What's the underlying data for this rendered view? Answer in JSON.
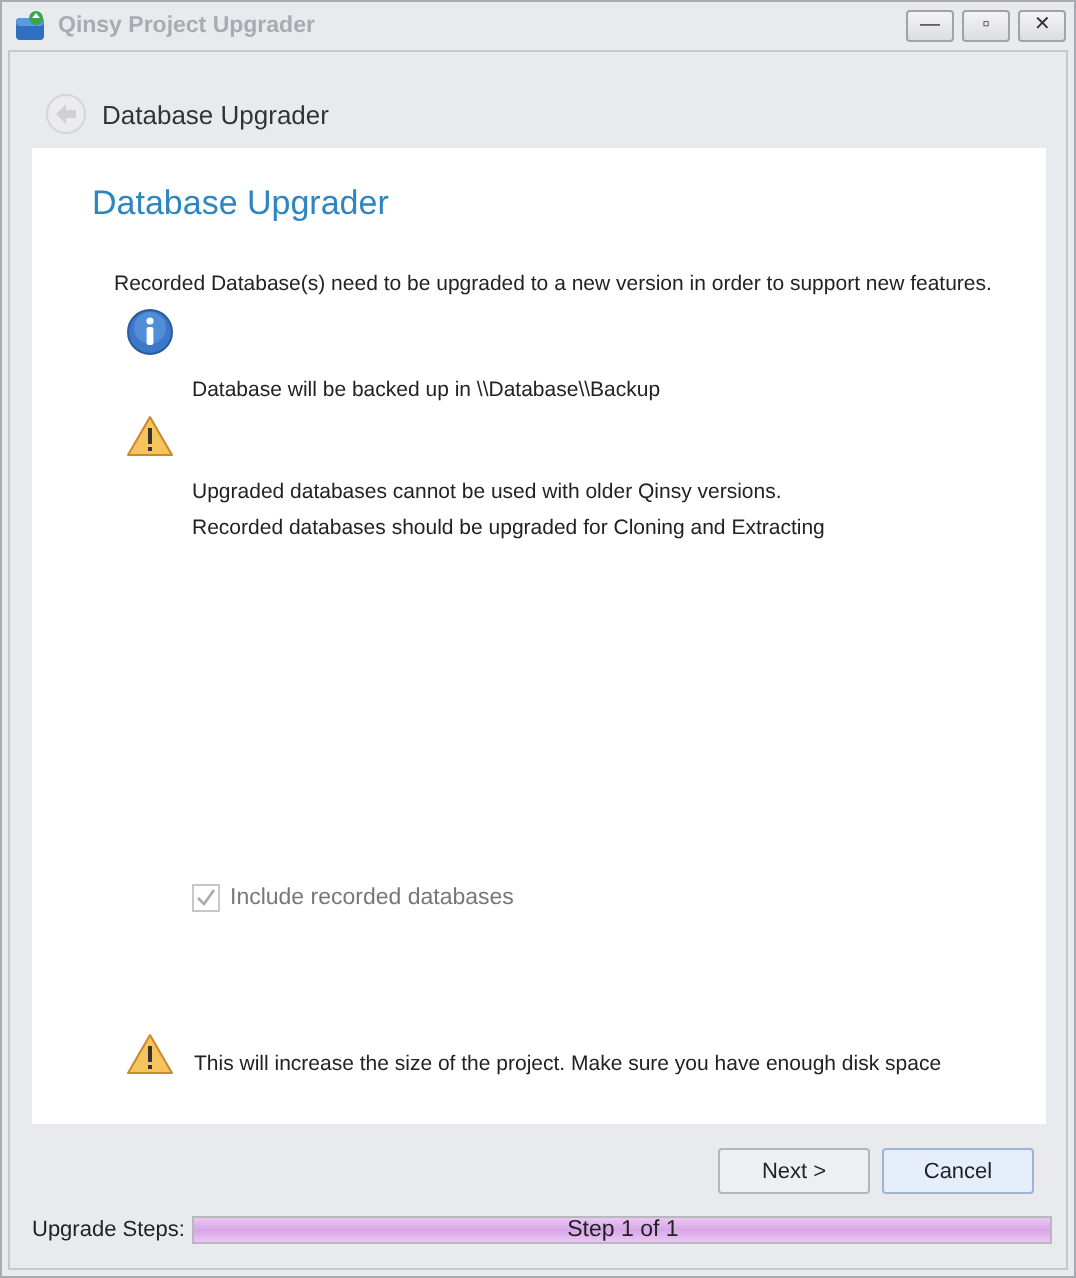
{
  "window": {
    "title": "Qinsy Project Upgrader",
    "controls": [
      "—",
      "▫",
      "✕"
    ]
  },
  "header": {
    "title": "Database Upgrader",
    "back_disabled": true
  },
  "panel": {
    "title": "Database Upgrader",
    "intro": "Recorded Database(s) need to be upgraded to a new version in order to support new features.",
    "messages": [
      {
        "kind": "info",
        "lines": [
          "Database will be backed up in \\\\Database\\\\Backup"
        ]
      },
      {
        "kind": "warning",
        "lines": [
          "Upgraded databases cannot be used with older Qinsy versions.",
          "Recorded databases should be upgraded for Cloning and Extracting"
        ]
      }
    ],
    "checkbox": {
      "label": "Include recorded databases",
      "checked": true,
      "disabled": true
    },
    "footer_warning": {
      "kind": "warning",
      "text": "This will increase the size of the project. Make sure you have enough disk space"
    }
  },
  "buttons": [
    {
      "label": "Next >",
      "focused": false
    },
    {
      "label": "Cancel",
      "focused": true
    }
  ],
  "steps": {
    "label": "Upgrade Steps:",
    "text": "Step 1 of 1",
    "level": 1
  }
}
